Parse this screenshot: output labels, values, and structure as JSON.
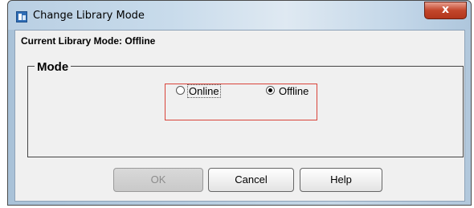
{
  "window": {
    "title": "Change Library Mode",
    "close_glyph": "x"
  },
  "status": {
    "current_mode_text": "Current Library Mode: Offline"
  },
  "mode_group": {
    "legend": "Mode",
    "options": [
      {
        "label": "Online",
        "selected": false
      },
      {
        "label": "Offline",
        "selected": true
      }
    ]
  },
  "buttons": {
    "ok_label": "OK",
    "ok_enabled": false,
    "cancel_label": "Cancel",
    "help_label": "Help"
  },
  "colors": {
    "highlight_border": "#d9443a",
    "close_button": "#c2462b"
  }
}
